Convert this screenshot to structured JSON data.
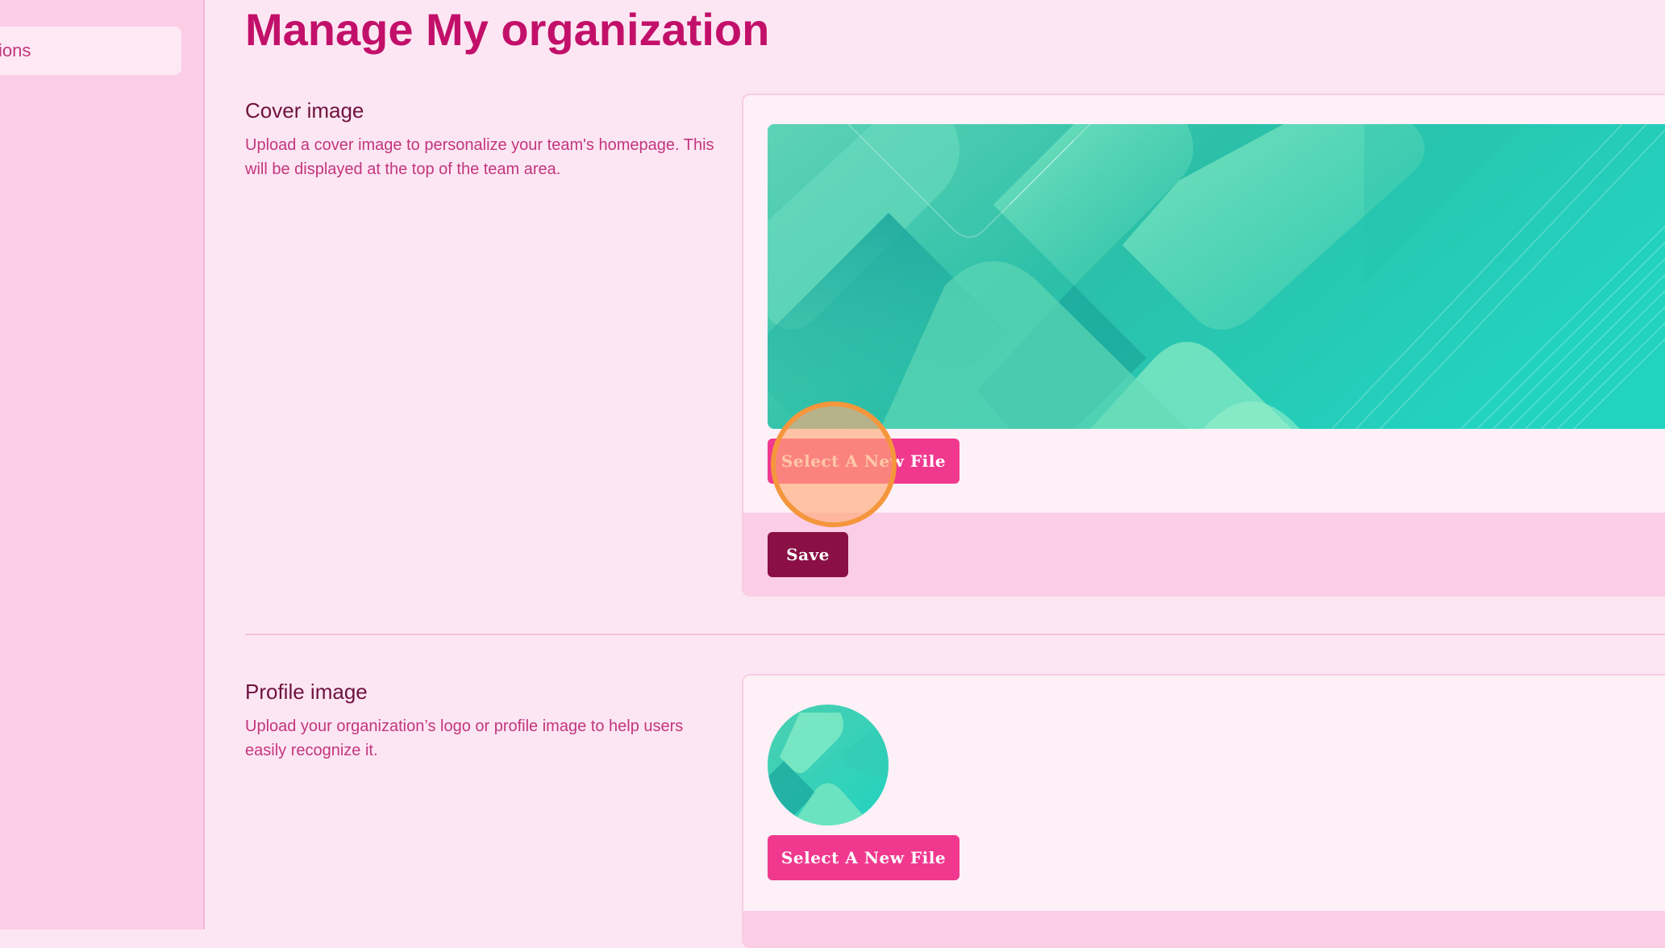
{
  "sidebar": {
    "items": [
      {
        "label": "ions"
      }
    ]
  },
  "page": {
    "title": "Manage My organization"
  },
  "cover_section": {
    "title": "Cover image",
    "description": "Upload a cover image to personalize your team's homepage. This will be displayed at the top of the team area.",
    "select_button": "Select A New File",
    "save_button": "Save"
  },
  "profile_section": {
    "title": "Profile image",
    "description": "Upload your organization’s logo or profile image to help users easily recognize it.",
    "select_button": "Select A New File"
  },
  "colors": {
    "background": "#fde6f3",
    "sidebar": "#fccde6",
    "accent": "#c2106a",
    "button_pink": "#f0398e",
    "button_save": "#8a0f45",
    "cursor_highlight": "#f5963c"
  }
}
